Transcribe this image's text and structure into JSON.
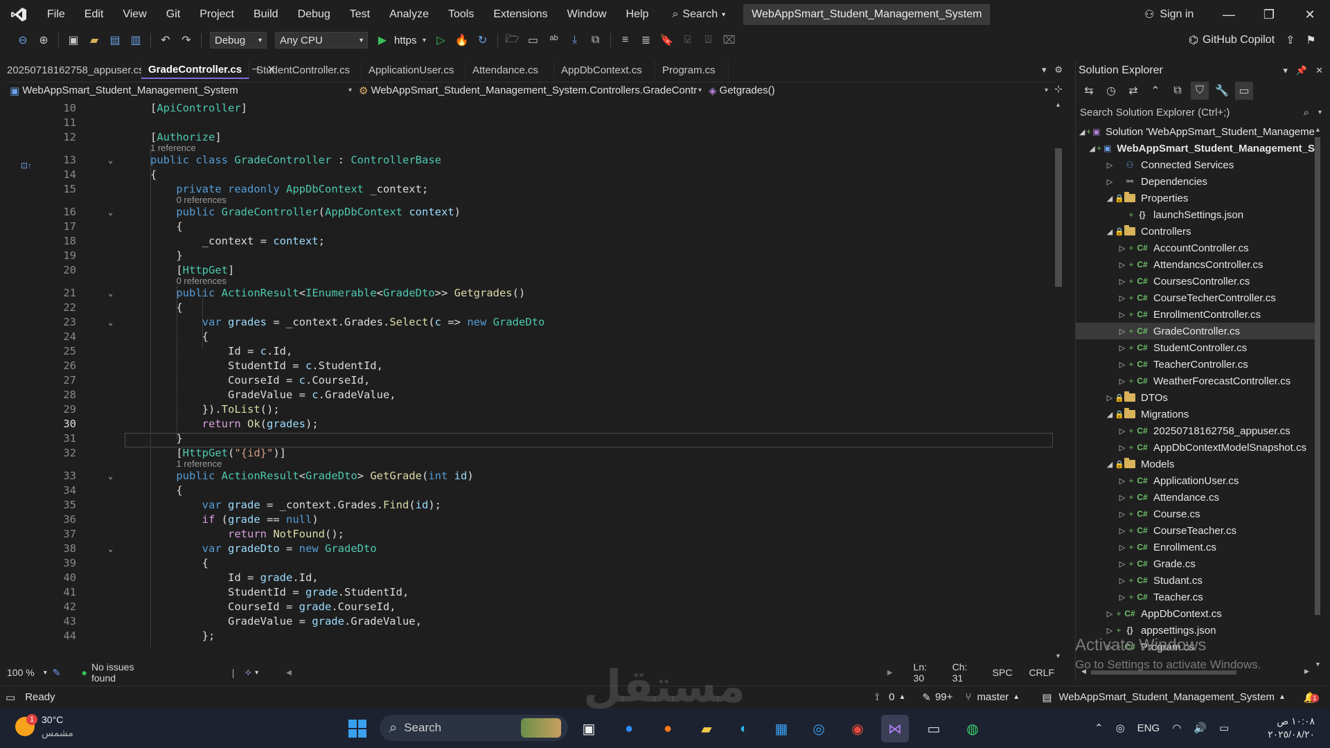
{
  "menu": {
    "items": [
      "File",
      "Edit",
      "View",
      "Git",
      "Project",
      "Build",
      "Debug",
      "Test",
      "Analyze",
      "Tools",
      "Extensions",
      "Window",
      "Help"
    ],
    "search_label": "Search",
    "solution_title": "WebAppSmart_Student_Management_System",
    "signin_label": "Sign in"
  },
  "toolbar": {
    "config": "Debug",
    "platform": "Any CPU",
    "run_label": "https",
    "copilot_label": "GitHub Copilot"
  },
  "tabs": [
    {
      "label": "20250718162758_appuser.cs",
      "active": false
    },
    {
      "label": "GradeController.cs",
      "active": true
    },
    {
      "label": "StudentController.cs",
      "active": false
    },
    {
      "label": "ApplicationUser.cs",
      "active": false
    },
    {
      "label": "Attendance.cs",
      "active": false
    },
    {
      "label": "AppDbContext.cs",
      "active": false
    },
    {
      "label": "Program.cs",
      "active": false
    }
  ],
  "navbar": {
    "project": "WebAppSmart_Student_Management_System",
    "class": "WebAppSmart_Student_Management_System.Controllers.GradeContr",
    "member": "Getgrades()"
  },
  "editor": {
    "lines": [
      {
        "n": "10",
        "code": "[ApiController]"
      },
      {
        "n": "11",
        "code": ""
      },
      {
        "n": "12",
        "code": "[Authorize]"
      },
      {
        "n": "13",
        "code": "public class GradeController : ControllerBase"
      },
      {
        "n": "14",
        "code": "{"
      },
      {
        "n": "15",
        "code": "    private readonly AppDbContext _context;"
      },
      {
        "n": "16",
        "code": "    public GradeController(AppDbContext context)"
      },
      {
        "n": "17",
        "code": "    {"
      },
      {
        "n": "18",
        "code": "        _context = context;"
      },
      {
        "n": "19",
        "code": "    }"
      },
      {
        "n": "20",
        "code": "    [HttpGet]"
      },
      {
        "n": "21",
        "code": "    public ActionResult<IEnumerable<GradeDto>> Getgrades()"
      },
      {
        "n": "22",
        "code": "    {"
      },
      {
        "n": "23",
        "code": "        var grades = _context.Grades.Select(c => new GradeDto"
      },
      {
        "n": "24",
        "code": "        {"
      },
      {
        "n": "25",
        "code": "            Id = c.Id,"
      },
      {
        "n": "26",
        "code": "            StudentId = c.StudentId,"
      },
      {
        "n": "27",
        "code": "            CourseId = c.CourseId,"
      },
      {
        "n": "28",
        "code": "            GradeValue = c.GradeValue,"
      },
      {
        "n": "29",
        "code": "        }).ToList();"
      },
      {
        "n": "30",
        "code": "        return Ok(grades);"
      },
      {
        "n": "31",
        "code": "    }"
      },
      {
        "n": "32",
        "code": "    [HttpGet(\"{id}\")]"
      },
      {
        "n": "33",
        "code": "    public ActionResult<GradeDto> GetGrade(int id)"
      },
      {
        "n": "34",
        "code": "    {"
      },
      {
        "n": "35",
        "code": "        var grade = _context.Grades.Find(id);"
      },
      {
        "n": "36",
        "code": "        if (grade == null)"
      },
      {
        "n": "37",
        "code": "            return NotFound();"
      },
      {
        "n": "38",
        "code": "        var gradeDto = new GradeDto"
      },
      {
        "n": "39",
        "code": "        {"
      },
      {
        "n": "40",
        "code": "            Id = grade.Id,"
      },
      {
        "n": "41",
        "code": "            StudentId = grade.StudentId,"
      },
      {
        "n": "42",
        "code": "            CourseId = grade.CourseId,"
      },
      {
        "n": "43",
        "code": "            GradeValue = grade.GradeValue,"
      },
      {
        "n": "44",
        "code": "        };"
      }
    ],
    "lens": {
      "after_12": "1 reference",
      "after_15": "0 references",
      "after_20": "0 references",
      "after_32": "1 reference"
    },
    "current_line": "30"
  },
  "editor_status": {
    "zoom": "100 %",
    "issues": "No issues found",
    "ln": "Ln: 30",
    "ch": "Ch: 31",
    "spc": "SPC",
    "eol": "CRLF"
  },
  "solution_explorer": {
    "title": "Solution Explorer",
    "search_placeholder": "Search Solution Explorer (Ctrl+;)",
    "items": [
      {
        "label": "Solution 'WebAppSmart_Student_Manageme",
        "kind": "solution"
      },
      {
        "label": "WebAppSmart_Student_Management_S",
        "kind": "project"
      },
      {
        "label": "Connected Services",
        "kind": "connected"
      },
      {
        "label": "Dependencies",
        "kind": "deps"
      },
      {
        "label": "Properties",
        "kind": "props"
      },
      {
        "label": "launchSettings.json",
        "kind": "json"
      },
      {
        "label": "Controllers",
        "kind": "folder"
      },
      {
        "label": "AccountController.cs",
        "kind": "cs"
      },
      {
        "label": "AttendancsController.cs",
        "kind": "cs"
      },
      {
        "label": "CoursesController.cs",
        "kind": "cs"
      },
      {
        "label": "CourseTecherController.cs",
        "kind": "cs"
      },
      {
        "label": "EnrollmentController.cs",
        "kind": "cs"
      },
      {
        "label": "GradeController.cs",
        "kind": "cs"
      },
      {
        "label": "StudentController.cs",
        "kind": "cs"
      },
      {
        "label": "TeacherController.cs",
        "kind": "cs"
      },
      {
        "label": "WeatherForecastController.cs",
        "kind": "cs"
      },
      {
        "label": "DTOs",
        "kind": "folder"
      },
      {
        "label": "Migrations",
        "kind": "folder"
      },
      {
        "label": "20250718162758_appuser.cs",
        "kind": "cs"
      },
      {
        "label": "AppDbContextModelSnapshot.cs",
        "kind": "cs"
      },
      {
        "label": "Models",
        "kind": "folder"
      },
      {
        "label": "ApplicationUser.cs",
        "kind": "cs"
      },
      {
        "label": "Attendance.cs",
        "kind": "cs"
      },
      {
        "label": "Course.cs",
        "kind": "cs"
      },
      {
        "label": "CourseTeacher.cs",
        "kind": "cs"
      },
      {
        "label": "Enrollment.cs",
        "kind": "cs"
      },
      {
        "label": "Grade.cs",
        "kind": "cs"
      },
      {
        "label": "Studant.cs",
        "kind": "cs"
      },
      {
        "label": "Teacher.cs",
        "kind": "cs"
      },
      {
        "label": "AppDbContext.cs",
        "kind": "cs"
      },
      {
        "label": "appsettings.json",
        "kind": "json"
      },
      {
        "label": "Program.cs",
        "kind": "cs"
      }
    ],
    "selected": "GradeController.cs"
  },
  "activation": {
    "line1": "Activate Windows",
    "line2": "Go to Settings to activate Windows."
  },
  "statusbar": {
    "ready": "Ready",
    "errors": "0",
    "edits": "99+",
    "branch": "master",
    "repo": "WebAppSmart_Student_Management_System",
    "notifications": "1"
  },
  "taskbar": {
    "weather_temp": "30°C",
    "weather_desc": "مشمس",
    "weather_badge": "1",
    "search_label": "Search",
    "lang": "ENG",
    "time": "١٠:٠٨ ص",
    "date": "٢٠٢٥/٠٨/٢٠"
  },
  "watermark": "مستقل"
}
